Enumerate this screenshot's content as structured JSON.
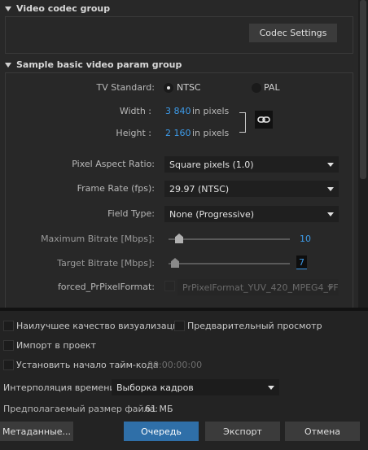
{
  "video_codec_group": {
    "title": "Video codec group",
    "codec_settings_button": "Codec Settings"
  },
  "basic_group": {
    "title": "Sample basic video param group",
    "tv_standard": {
      "label": "TV Standard:",
      "options": [
        "NTSC",
        "PAL"
      ],
      "selected": "NTSC"
    },
    "width": {
      "label": "Width :",
      "value": "3 840",
      "unit": "in pixels"
    },
    "height": {
      "label": "Height :",
      "value": "2 160",
      "unit": "in pixels"
    },
    "pixel_aspect": {
      "label": "Pixel Aspect Ratio:",
      "value": "Square pixels (1.0)"
    },
    "frame_rate": {
      "label": "Frame Rate (fps):",
      "value": "29.97 (NTSC)"
    },
    "field_type": {
      "label": "Field Type:",
      "value": "None (Progressive)"
    },
    "max_bitrate": {
      "label": "Maximum Bitrate [Mbps]:",
      "value": "10"
    },
    "target_bitrate": {
      "label": "Target Bitrate [Mbps]:",
      "value": "7"
    },
    "forced_format": {
      "label": "forced_PrPixelFormat:",
      "value": "PrPixelFormat_YUV_420_MPEG4_FF"
    }
  },
  "options": {
    "best_quality": "Наилучшее качество визуализации",
    "preview": "Предварительный просмотр",
    "import_project": "Импорт в проект",
    "set_timecode": "Установить начало тайм-кода",
    "timecode_value": "00:00:00:00"
  },
  "interpolation": {
    "label": "Интерполяция времени:",
    "value": "Выборка кадров"
  },
  "file_size": {
    "label": "Предполагаемый размер файла:",
    "value": "61 МБ"
  },
  "buttons": {
    "metadata": "Метаданные...",
    "queue": "Очередь",
    "export": "Экспорт",
    "cancel": "Отмена"
  },
  "colors": {
    "accent_blue": "#3d9be9",
    "primary_button": "#2f6fa8"
  }
}
